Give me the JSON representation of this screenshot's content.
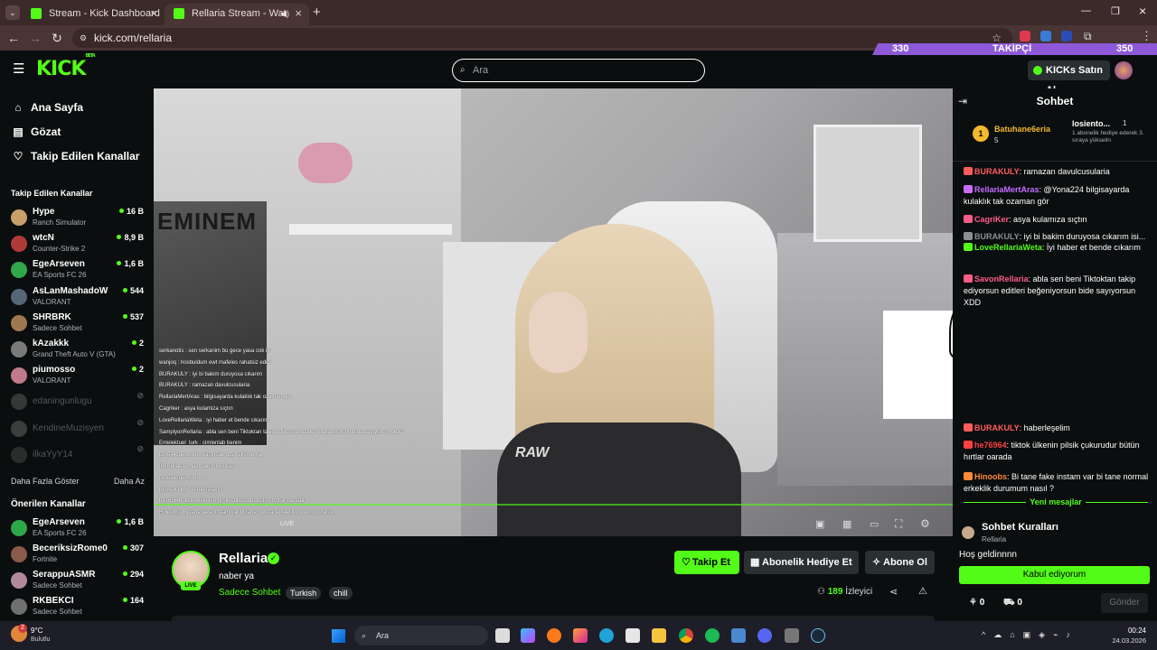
{
  "browser": {
    "tabs": [
      {
        "title": "Stream - Kick Dashboard",
        "active": false
      },
      {
        "title": "Rellaria Stream - Watch Live",
        "active": true
      }
    ],
    "new_tab": "+",
    "url": "kick.com/rellaria"
  },
  "header": {
    "logo": "KICK",
    "logo_badge": "BETA",
    "search_placeholder": "Ara",
    "follow_goal": {
      "current": "330",
      "label": "TAKİPÇİ",
      "target": "350",
      "progress": 0.94
    },
    "buy_kicks": "KICKs Satın Al"
  },
  "sidebar": {
    "nav": [
      "Ana Sayfa",
      "Gözat",
      "Takip Edilen Kanallar"
    ],
    "followed_title": "Takip Edilen Kanallar",
    "followed": [
      {
        "name": "Hype",
        "category": "Ranch Simulator",
        "viewers": "16 B",
        "live": true,
        "color": "#c9a06a"
      },
      {
        "name": "wtcN",
        "category": "Counter-Strike 2",
        "viewers": "8,9 B",
        "live": true,
        "color": "#b03a3a"
      },
      {
        "name": "EgeArseven",
        "category": "EA Sports FC 26",
        "viewers": "1,6 B",
        "live": true,
        "color": "#2fa84a"
      },
      {
        "name": "AsLanMashadoW",
        "category": "VALORANT",
        "viewers": "544",
        "live": true,
        "color": "#556677"
      },
      {
        "name": "SHRBRK",
        "category": "Sadece Sohbet",
        "viewers": "537",
        "live": true,
        "color": "#a07850"
      },
      {
        "name": "kAzakkk",
        "category": "Grand Theft Auto V (GTA)",
        "viewers": "2",
        "live": true,
        "color": "#7a7a7a"
      },
      {
        "name": "piumosso",
        "category": "VALORANT",
        "viewers": "2",
        "live": true,
        "color": "#c07a8a"
      },
      {
        "name": "edaningunlugu",
        "category": "",
        "viewers": "",
        "live": false,
        "color": "#888888"
      },
      {
        "name": "KendineMuzisyen",
        "category": "",
        "viewers": "",
        "live": false,
        "color": "#999999"
      },
      {
        "name": "ilkaYyY14",
        "category": "",
        "viewers": "",
        "live": false,
        "color": "#666666"
      }
    ],
    "show_more": "Daha Fazla Göster",
    "show_less": "Daha Az",
    "recommended_title": "Önerilen Kanallar",
    "recommended": [
      {
        "name": "EgeArseven",
        "category": "EA Sports FC 26",
        "viewers": "1,6 B",
        "color": "#2fa84a"
      },
      {
        "name": "BeceriksizRome0",
        "category": "Fortnite",
        "viewers": "307",
        "color": "#8a5a4a"
      },
      {
        "name": "SerappuASMR",
        "category": "Sadece Sohbet",
        "viewers": "294",
        "color": "#b08a9a"
      },
      {
        "name": "RKBEKCI",
        "category": "Sadece Sohbet",
        "viewers": "164",
        "color": "#707070"
      }
    ]
  },
  "video": {
    "wall_text": "EMINEM",
    "shirt_text": "RAW",
    "overlay_chat": [
      "serkanotis : sen serkanim bu gece yasa cok iyi",
      "wanjoq : hosbuldum ewt mafeles rahatsiz edici",
      "BURAKULY : iyi bi bakim duruyosa cıkarım",
      "BURAKULY : ramazan davulcusularia",
      "RellariaMertAras : bilgisayarda kulaklık tak ozaman gör",
      "Cagriker : asya kulamiza sıçtın",
      "LoveRellariaWeta : iyi haber et bende cıkarım",
      "SamplyonRellaria : abla sen beni Tiktoktan takip ediyorsun editleri beğeniyorsun bide sayıyorsun XDD",
      "Entelektuel_turk : cimlenlab benim",
      "Entelektuel_turk : yaşından ozur dileme ya",
      "IboRellaria : hacı senin boy kaç",
      "Entelektuel_turk : ...",
      "BURAKULY : haberleşelim",
      "he76964 : tiktok ülkenin pilsik çukurudur bütün hırtlar oarada",
      "Hinoobs : Bi tane fake instam var bi tane normal erkeklik durumum nasıl ?"
    ],
    "live_tag": "LIVE"
  },
  "channel": {
    "name": "Rellaria",
    "title": "naber ya",
    "category": "Sadece Sohbet",
    "tags": [
      "Turkish",
      "chill"
    ],
    "live_badge": "LIVE",
    "follow_btn": "Takip Et",
    "gift_btn": "Abonelik Hediye Et",
    "sub_btn": "Abone Ol",
    "viewers": "189",
    "viewers_label": "İzleyici"
  },
  "chat": {
    "title": "Sohbet",
    "top_gifter": {
      "rank": "1",
      "name": "Batuhane6eria",
      "count": "5"
    },
    "top_gifter2": {
      "name": "losiento...",
      "count": "1",
      "note": "1 abonelik hediye ederek 3. sıraya yükselin"
    },
    "messages": [
      {
        "user": "BURAKULY",
        "text": "ramazan davulcusularia",
        "color": "#ff5c5c"
      },
      {
        "user": "RellariaMertAras",
        "text": "@Yona224 bilgisayarda kulaklık tak ozaman gör",
        "color": "#c86bff"
      },
      {
        "user": "CagriKer",
        "text": "asya kulamıza sıçtın",
        "color": "#ff5c8a"
      },
      {
        "user": "BURAKULY",
        "text": "iyi bi bakim duruyosa cıkarım isi...",
        "color": "#8a8f93"
      },
      {
        "user": "LoveRellariaWeta",
        "text": "İyi haber et bende cıkarım",
        "color": "#53fc18"
      },
      {
        "user": "SavonRellaria",
        "text": "abla sen beni Tiktoktan takip ediyorsun editleri beğeniyorsun bide sayıyorsun XDD",
        "color": "#ff5c8a"
      },
      {
        "user": "BURAKULY",
        "text": "haberleşelim",
        "color": "#ff5c5c"
      },
      {
        "user": "he76964",
        "text": "tiktok ülkenin pilsik çukurudur bütün hırtlar oarada",
        "color": "#ff4040"
      },
      {
        "user": "Hinoobs",
        "text": "Bi tane fake instam var bi tane normal erkeklik durumum nasıl ?",
        "color": "#ff8a3a"
      }
    ],
    "new_messages": "Yeni mesajlar",
    "rules_title": "Sohbet Kuralları",
    "rules_sub": "Rellaria",
    "welcome": "Hoş geldinnnn",
    "accept_btn": "Kabul ediyorum",
    "kicks_count": "0",
    "gift_count": "0",
    "send_btn": "Gönder"
  },
  "taskbar": {
    "weather_temp": "9°C",
    "weather_desc": "Bulutlu",
    "weather_badge": "2",
    "search": "Ara",
    "time": "00:24",
    "date": "24.03.2026"
  },
  "colors": {
    "kick_green": "#53fc18",
    "bg": "#0b0e0f",
    "card": "#2a2f31",
    "follow_bar": "#8e59d9"
  }
}
